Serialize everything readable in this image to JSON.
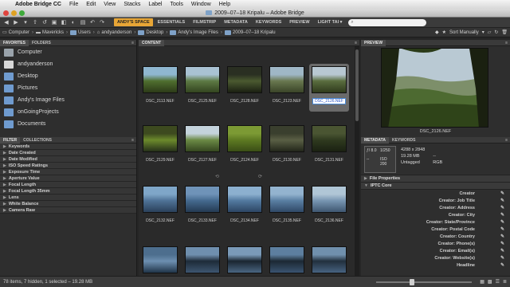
{
  "menubar": {
    "items": [
      "Adobe Bridge CC",
      "File",
      "Edit",
      "View",
      "Stacks",
      "Label",
      "Tools",
      "Window",
      "Help"
    ]
  },
  "window": {
    "title": "2009–07–18 Kripalu – Adobe Bridge"
  },
  "toolbar": {
    "workspaces": [
      "ANDY'S SPACE",
      "ESSENTIALS",
      "FILMSTRIP",
      "METADATA",
      "KEYWORDS",
      "PREVIEW",
      "LIGHT TAI ▾"
    ],
    "active_workspace": "ANDY'S SPACE",
    "search_placeholder": "",
    "accent_color": "#e8a636"
  },
  "breadcrumb": [
    "Computer",
    "Mavericks",
    "Users",
    "andyanderson",
    "Desktop",
    "Andy's Image Files",
    "2009–07–18 Kripalu"
  ],
  "sort": {
    "label": "Sort Manually"
  },
  "favorites": {
    "tabs": [
      "FAVORITES",
      "FOLDERS"
    ],
    "items": [
      {
        "label": "Computer",
        "icon": "computer-icon"
      },
      {
        "label": "andyanderson",
        "icon": "home-icon"
      },
      {
        "label": "Desktop",
        "icon": "folder-icon"
      },
      {
        "label": "Pictures",
        "icon": "folder-icon"
      },
      {
        "label": "Andy's Image Files",
        "icon": "folder-icon"
      },
      {
        "label": "onGoingProjects",
        "icon": "folder-icon"
      },
      {
        "label": "Documents",
        "icon": "folder-icon"
      }
    ]
  },
  "filter": {
    "tabs": [
      "FILTER",
      "COLLECTIONS"
    ],
    "items": [
      "Keywords",
      "Date Created",
      "Date Modified",
      "ISO Speed Ratings",
      "Exposure Time",
      "Aperture Value",
      "Focal Length",
      "Focal Length 35mm",
      "Lens",
      "White Balance",
      "Camera Raw"
    ]
  },
  "content": {
    "tab": "CONTENT",
    "thumbnails": [
      {
        "name": "DSC_2113.NEF",
        "colors": [
          "#8fb7d0",
          "#4f6f2f",
          "#2c3a18"
        ]
      },
      {
        "name": "DSC_2125.NEF",
        "colors": [
          "#a9c2d3",
          "#5d7a44",
          "#33441f"
        ]
      },
      {
        "name": "DSC_2128.NEF",
        "colors": [
          "#2a2f22",
          "#4b5a30",
          "#1a1f12"
        ]
      },
      {
        "name": "DSC_2123.NEF",
        "colors": [
          "#9fb7c6",
          "#69784f",
          "#3a4428"
        ]
      },
      {
        "name": "DSC_2126.NEF",
        "colors": [
          "#b8c8d2",
          "#5a6d3e",
          "#2f3a1d"
        ],
        "selected": true
      },
      {
        "name": "DSC_2129.NEF",
        "colors": [
          "#3d4a1f",
          "#6c8a2c",
          "#26301a"
        ]
      },
      {
        "name": "DSC_2127.NEF",
        "colors": [
          "#c4d3dc",
          "#6b8a45",
          "#34461f"
        ]
      },
      {
        "name": "DSC_2124.NEF",
        "colors": [
          "#7c9a34",
          "#5d7a22",
          "#3a4d16"
        ]
      },
      {
        "name": "DSC_2130.NEF",
        "colors": [
          "#3a3f2e",
          "#5a5f45",
          "#22261a"
        ]
      },
      {
        "name": "DSC_2131.NEF",
        "colors": [
          "#4a5532",
          "#2f3a1f",
          "#1b2112"
        ]
      },
      {
        "name": "DSC_2132.NEF",
        "colors": [
          "#7fa6c8",
          "#4f7397",
          "#2a405a"
        ]
      },
      {
        "name": "DSC_2133.NEF",
        "colors": [
          "#6f93b8",
          "#456a8f",
          "#243a52"
        ]
      },
      {
        "name": "DSC_2134.NEF",
        "colors": [
          "#8cb0cf",
          "#537aa0",
          "#2c4563"
        ]
      },
      {
        "name": "DSC_2135.NEF",
        "colors": [
          "#93b3cf",
          "#5a7fa3",
          "#2f4866"
        ]
      },
      {
        "name": "DSC_2136.NEF",
        "colors": [
          "#b0c6d6",
          "#7896b2",
          "#3e5670"
        ]
      },
      {
        "name": "",
        "colors": [
          "#4d6e8e",
          "#6d8fb0",
          "#203448"
        ]
      },
      {
        "name": "",
        "colors": [
          "#6f8fae",
          "#1e2b38",
          "#3d5670"
        ]
      },
      {
        "name": "",
        "colors": [
          "#7a9ab8",
          "#1a2530",
          "#4a6682"
        ]
      },
      {
        "name": "",
        "colors": [
          "#5d7f9f",
          "#1c2833",
          "#3a5470"
        ]
      },
      {
        "name": "",
        "colors": [
          "#7090ad",
          "#22303d",
          "#476381"
        ]
      }
    ]
  },
  "preview": {
    "tab": "PREVIEW",
    "caption": "DSC_2126.NEF"
  },
  "metadata": {
    "tabs": [
      "METADATA",
      "KEYWORDS"
    ],
    "camera": {
      "aperture": "ƒ/ 8.0",
      "shutter": "1/250",
      "iso": "ISO 200",
      "ev": "--"
    },
    "summary": {
      "dimensions": "4288 x 2848",
      "size": "19.28 MB",
      "dash": "--",
      "profile": "Untagged",
      "mode": "RGB"
    },
    "sections": [
      "File Properties",
      "IPTC Core"
    ],
    "fields": [
      "Creator",
      "Creator: Job Title",
      "Creator: Address",
      "Creator: City",
      "Creator: State/Province",
      "Creator: Postal Code",
      "Creator: Country",
      "Creator: Phone(s)",
      "Creator: Email(s)",
      "Creator: Website(s)",
      "Headline"
    ]
  },
  "status": {
    "text": "78 items, 7 hidden, 1 selected – 19.28 MB"
  }
}
